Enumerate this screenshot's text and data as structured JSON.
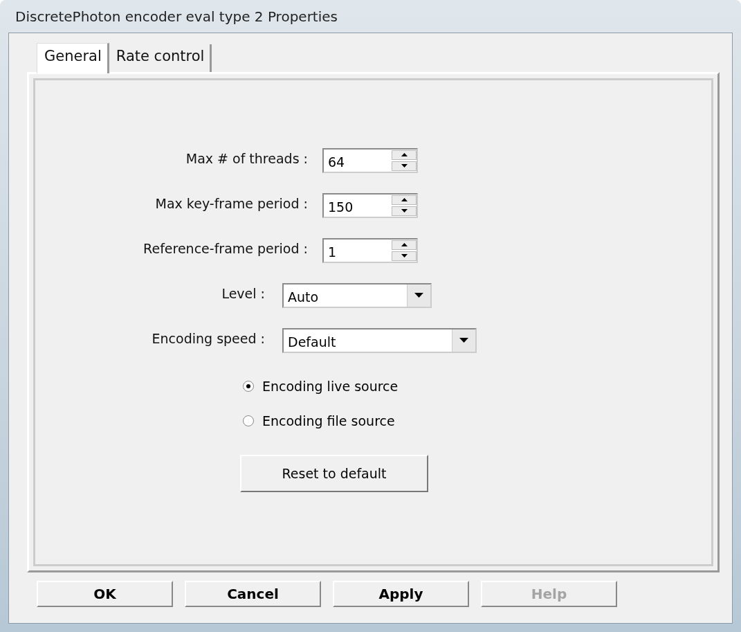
{
  "window": {
    "title": "DiscretePhoton encoder eval type 2 Properties"
  },
  "tabs": [
    {
      "label": "General",
      "selected": true
    },
    {
      "label": "Rate control",
      "selected": false
    }
  ],
  "fields": [
    {
      "kind": "spin",
      "label": "Max # of threads :",
      "value": "64"
    },
    {
      "kind": "spin",
      "label": "Max key-frame period :",
      "value": "150"
    },
    {
      "kind": "spin",
      "label": "Reference-frame period :",
      "value": "1"
    },
    {
      "kind": "dropdown",
      "label": "Level :",
      "value": "Auto"
    },
    {
      "kind": "dropdown",
      "label": "Encoding speed :",
      "value": "Default"
    }
  ],
  "radios": [
    {
      "label": "Encoding live source",
      "selected": true
    },
    {
      "label": "Encoding file source",
      "selected": false
    }
  ],
  "reset_button": {
    "label": "Reset to default"
  },
  "buttons": [
    {
      "label": "OK",
      "disabled": false
    },
    {
      "label": "Cancel",
      "disabled": false
    },
    {
      "label": "Apply",
      "disabled": false
    },
    {
      "label": "Help",
      "disabled": true
    }
  ]
}
